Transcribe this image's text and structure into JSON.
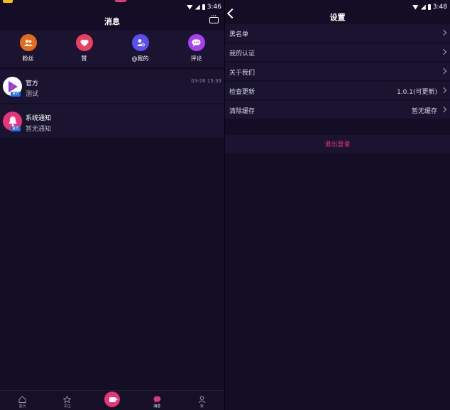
{
  "left": {
    "status_time": "3:46",
    "title": "消息",
    "quick_actions": [
      {
        "label": "粉丝",
        "color": "#e66a1c",
        "icon": "fans-icon"
      },
      {
        "label": "赞",
        "color": "#e8405e",
        "icon": "heart-icon"
      },
      {
        "label": "@我的",
        "color": "#5a4ff0",
        "icon": "mention-icon"
      },
      {
        "label": "评论",
        "color": "#a83ff0",
        "icon": "comment-icon"
      }
    ],
    "conversations": [
      {
        "name": "官方",
        "preview": "测试",
        "time": "03-26 15:33",
        "tag": "官方",
        "avatar_color": "#ffffff"
      },
      {
        "name": "系统通知",
        "preview": "暂无通知",
        "time": "",
        "tag": "官方",
        "avatar_color": "#e8357a"
      }
    ],
    "tabs": [
      {
        "label": "首页",
        "icon": "home-icon"
      },
      {
        "label": "关注",
        "icon": "star-icon"
      },
      {
        "label": "",
        "icon": "camera-icon"
      },
      {
        "label": "消息",
        "icon": "message-icon"
      },
      {
        "label": "我",
        "icon": "profile-icon"
      }
    ]
  },
  "right": {
    "status_time": "3:48",
    "title": "设置",
    "rows": [
      {
        "label": "黑名单",
        "value": ""
      },
      {
        "label": "我的认证",
        "value": ""
      },
      {
        "label": "关于我们",
        "value": ""
      },
      {
        "label": "检查更新",
        "value": "1.0.1(可更新)"
      },
      {
        "label": "清除缓存",
        "value": "暂无缓存"
      }
    ],
    "logout_label": "退出登录"
  },
  "colors": {
    "background": "#130e25",
    "panel": "#1a1431",
    "accent": "#e8357a"
  }
}
